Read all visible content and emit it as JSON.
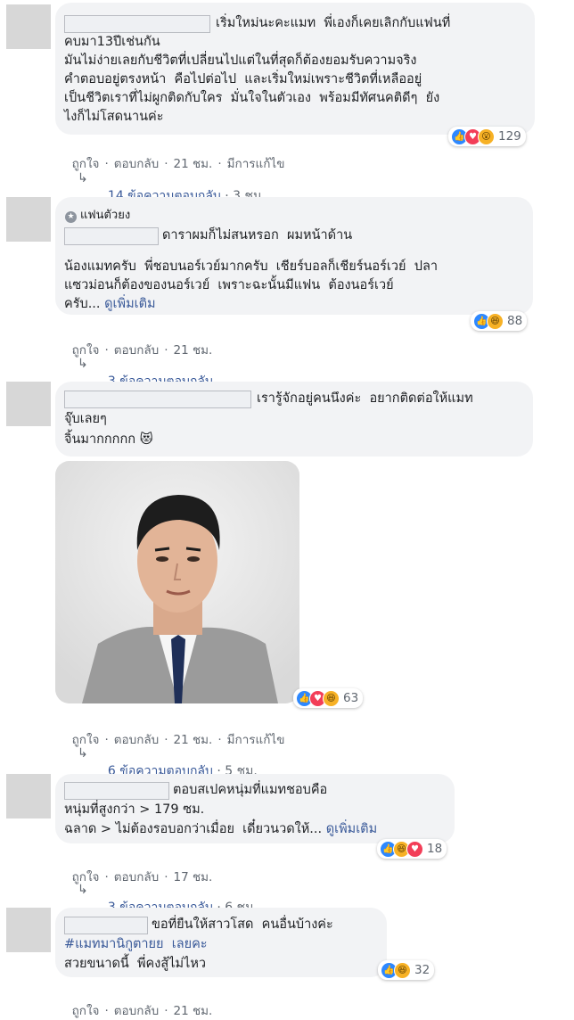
{
  "comments": [
    {
      "lines": [
        "เริ่มใหม่นะคะแมท  พี่เองก็เคยเลิกกับแฟนที่",
        "คบมา13ปีเช่นกัน",
        "มันไม่ง่ายเลยกับชีวิตที่เปลี่ยนไปแต่ในที่สุดก็ต้องยอมรับความจริง",
        "คำตอบอยู่ตรงหน้า  คือไปต่อไป  และเริ่มใหม่เพราะชีวิตที่เหลืออยู่",
        "เป็นชีวิตเราที่ไม่ผูกติดกับใคร  มั่นใจในตัวเอง  พร้อมมีทัศนคติดีๆ  ยัง",
        "ไงก็ไม่โสดนานค่ะ"
      ],
      "actions": {
        "like": "ถูกใจ",
        "reply": "ตอบกลับ",
        "time": "21 ชม.",
        "edited": "มีการแก้ไข"
      },
      "reactions": {
        "icons": [
          "like-icon",
          "love-icon",
          "wow-icon"
        ],
        "count": "129"
      },
      "replies": {
        "text": "14 ข้อความตอบกลับ",
        "time": "3 ชม."
      }
    },
    {
      "badge": "แฟนตัวยง",
      "lines": [
        "ดาราผมก็ไม่สนหรอก  ผมหน้าด้าน",
        "",
        "น้องแมทครับ  พี่ชอบนอร์เวย์มากครับ  เชียร์บอลก็เชียร์นอร์เวย์  ปลา",
        "แซวม่อนก็ต้องของนอร์เวย์  เพราะฉะนั้นมีแฟน  ต้องนอร์เวย์",
        "ครับ..."
      ],
      "see_more": "ดูเพิ่มเติม",
      "actions": {
        "like": "ถูกใจ",
        "reply": "ตอบกลับ",
        "time": "21 ชม."
      },
      "reactions": {
        "icons": [
          "like-icon",
          "haha-icon"
        ],
        "count": "88"
      },
      "replies": {
        "text": "3 ข้อความตอบกลับ"
      }
    },
    {
      "lines": [
        "เรารู้จักอยู่คนนึงค่ะ  อยากติดต่อให้แมท",
        "จุ๊บเลยๆ",
        "จิ้นมากกกกก"
      ],
      "emoji": "😻",
      "actions": {
        "like": "ถูกใจ",
        "reply": "ตอบกลับ",
        "time": "21 ชม.",
        "edited": "มีการแก้ไข"
      },
      "reactions": {
        "icons": [
          "like-icon",
          "love-icon",
          "haha-icon"
        ],
        "count": "63"
      },
      "replies": {
        "text": "6 ข้อความตอบกลับ",
        "time": "5 ชม."
      }
    },
    {
      "lines": [
        "ตอบสเปคหนุ่มที่แมทชอบคือ",
        "หนุ่มที่สูงกว่า > 179 ซม.",
        "ฉลาด > ไม่ต้องรอบอกว่าเมื่อย  เดี๋ยวนวดให้..."
      ],
      "see_more": "ดูเพิ่มเติม",
      "actions": {
        "like": "ถูกใจ",
        "reply": "ตอบกลับ",
        "time": "17 ชม."
      },
      "reactions": {
        "icons": [
          "like-icon",
          "haha-icon",
          "love-icon"
        ],
        "count": "18"
      },
      "replies": {
        "text": "3 ข้อความตอบกลับ",
        "time": "6 ชม."
      }
    },
    {
      "lines": [
        "ขอที่ยืนให้สาวโสด  คนอื่นบ้างค่ะ",
        "#แมทมานิกูตายย  เลยคะ",
        "สวยขนาดนี้  พี่คงสู้ไม่ไหว"
      ],
      "actions": {
        "like": "ถูกใจ",
        "reply": "ตอบกลับ",
        "time": "21 ชม."
      },
      "reactions": {
        "icons": [
          "like-icon",
          "haha-icon"
        ],
        "count": "32"
      }
    }
  ]
}
